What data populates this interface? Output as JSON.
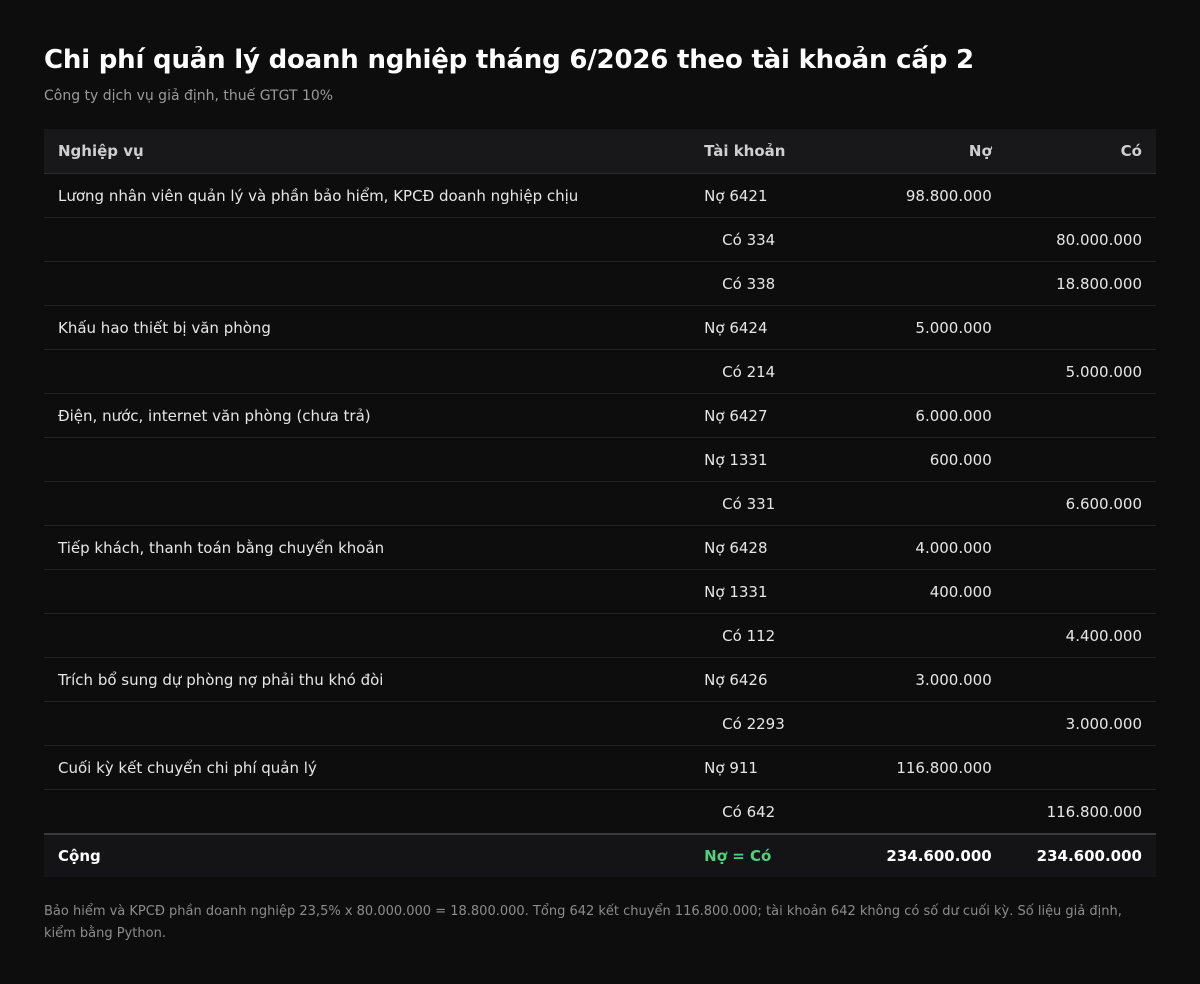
{
  "title": "Chi phí quản lý doanh nghiệp tháng 6/2026 theo tài khoản cấp 2",
  "subtitle": "Công ty dịch vụ giả định, thuế GTGT 10%",
  "table": {
    "headers": {
      "desc": "Nghiệp vụ",
      "account": "Tài khoản",
      "debit": "Nợ",
      "credit": "Có"
    },
    "rows": [
      {
        "desc": "Lương nhân viên quản lý và phần bảo hiểm, KPCĐ doanh nghiệp chịu",
        "account": "Nợ 6421",
        "side": "debit",
        "debit": "98.800.000",
        "credit": ""
      },
      {
        "desc": "",
        "account": "Có 334",
        "side": "credit",
        "debit": "",
        "credit": "80.000.000"
      },
      {
        "desc": "",
        "account": "Có 338",
        "side": "credit",
        "debit": "",
        "credit": "18.800.000"
      },
      {
        "desc": "Khấu hao thiết bị văn phòng",
        "account": "Nợ 6424",
        "side": "debit",
        "debit": "5.000.000",
        "credit": ""
      },
      {
        "desc": "",
        "account": "Có 214",
        "side": "credit",
        "debit": "",
        "credit": "5.000.000"
      },
      {
        "desc": "Điện, nước, internet văn phòng (chưa trả)",
        "account": "Nợ 6427",
        "side": "debit",
        "debit": "6.000.000",
        "credit": ""
      },
      {
        "desc": "",
        "account": "Nợ 1331",
        "side": "debit",
        "debit": "600.000",
        "credit": ""
      },
      {
        "desc": "",
        "account": "Có 331",
        "side": "credit",
        "debit": "",
        "credit": "6.600.000"
      },
      {
        "desc": "Tiếp khách, thanh toán bằng chuyển khoản",
        "account": "Nợ 6428",
        "side": "debit",
        "debit": "4.000.000",
        "credit": ""
      },
      {
        "desc": "",
        "account": "Nợ 1331",
        "side": "debit",
        "debit": "400.000",
        "credit": ""
      },
      {
        "desc": "",
        "account": "Có 112",
        "side": "credit",
        "debit": "",
        "credit": "4.400.000"
      },
      {
        "desc": "Trích bổ sung dự phòng nợ phải thu khó đòi",
        "account": "Nợ 6426",
        "side": "debit",
        "debit": "3.000.000",
        "credit": ""
      },
      {
        "desc": "",
        "account": "Có 2293",
        "side": "credit",
        "debit": "",
        "credit": "3.000.000"
      },
      {
        "desc": "Cuối kỳ kết chuyển chi phí quản lý",
        "account": "Nợ 911",
        "side": "debit",
        "debit": "116.800.000",
        "credit": ""
      },
      {
        "desc": "",
        "account": "Có 642",
        "side": "credit",
        "debit": "",
        "credit": "116.800.000"
      }
    ],
    "total": {
      "label": "Cộng",
      "account": "Nợ = Có",
      "debit": "234.600.000",
      "credit": "234.600.000"
    }
  },
  "note": "Bảo hiểm và KPCĐ phần doanh nghiệp 23,5% x 80.000.000 = 18.800.000. Tổng 642 kết chuyển 116.800.000; tài khoản 642 không có số dư cuối kỳ. Số liệu giả định, kiểm bằng Python.",
  "colors": {
    "background": "#0d0d0d",
    "debit_account": "#6f9cf0",
    "credit_account": "#efa14a",
    "balance_ok": "#4fd27e"
  }
}
